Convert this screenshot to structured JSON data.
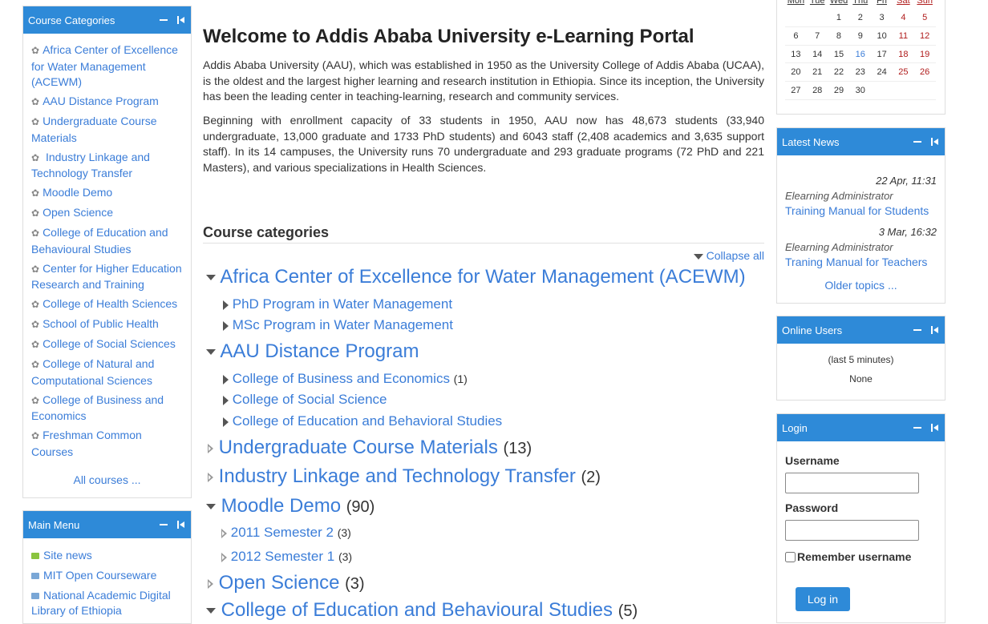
{
  "left": {
    "categories_block": {
      "title": "Course Categories",
      "items": [
        "Africa Center of Excellence for Water Management (ACEWM)",
        "AAU Distance Program",
        "Undergraduate Course Materials",
        " Industry Linkage and Technology Transfer",
        "Moodle Demo",
        "Open Science",
        "College of Education and Behavioural Studies",
        "Center for Higher Education Research and Training",
        "College of Health Sciences",
        "School of Public Health",
        "College of Social Sciences",
        "College of Natural and Computational Sciences",
        "College of Business and Economics",
        "Freshman Common Courses"
      ],
      "all_courses": "All courses ..."
    },
    "main_menu": {
      "title": "Main Menu",
      "items": [
        {
          "label": "Site news",
          "icon": "forum-icon"
        },
        {
          "label": "MIT Open Courseware",
          "icon": "url-icon"
        },
        {
          "label": "National Academic Digital Library of Ethiopia",
          "icon": "url-icon"
        }
      ]
    }
  },
  "main": {
    "title": "Welcome to Addis Ababa University e-Learning Portal",
    "paragraphs": [
      "Addis Ababa University (AAU), which was established in 1950 as the University College of Addis Ababa (UCAA), is the oldest and the largest higher learning and research institution in Ethiopia. Since its inception, the University has been the leading center in teaching-learning, research and community services.",
      "Beginning with enrollment capacity of 33 students in 1950, AAU now has 48,673 students (33,940 undergraduate, 13,000 graduate and 1733 PhD students) and 6043 staff (2,408 academics and 3,635 support staff). In its 14 campuses, the University runs 70 undergraduate and 293 graduate programs (72 PhD and 221 Masters), and various specializations in Health Sciences."
    ],
    "categories_heading": "Course categories",
    "collapse_all": "Collapse all",
    "tree": [
      {
        "label": "Africa Center of Excellence for Water Management (ACEWM)",
        "count": ""
      },
      {
        "label": "PhD Program in Water Management",
        "count": ""
      },
      {
        "label": "MSc Program in Water Management",
        "count": ""
      },
      {
        "label": "AAU Distance Program",
        "count": ""
      },
      {
        "label": "College of Business and Economics",
        "count": "(1)"
      },
      {
        "label": "College of Social Science",
        "count": ""
      },
      {
        "label": "College of Education and Behavioral Studies",
        "count": ""
      },
      {
        "label": "Undergraduate Course Materials",
        "count": "(13)"
      },
      {
        "label": "Industry Linkage and Technology Transfer",
        "count": "(2)"
      },
      {
        "label": "Moodle Demo",
        "count": "(90)"
      },
      {
        "label": "2011 Semester 2",
        "count": "(3)"
      },
      {
        "label": "2012 Semester 1",
        "count": "(3)"
      },
      {
        "label": "Open Science",
        "count": "(3)"
      },
      {
        "label": "College of Education and Behavioural Studies",
        "count": "(5)"
      }
    ]
  },
  "right": {
    "calendar": {
      "weekdays": [
        "Mon",
        "Tue",
        "Wed",
        "Thu",
        "Fri",
        "Sat",
        "Sun"
      ],
      "weeks": [
        [
          "",
          "",
          "1",
          "2",
          "3",
          "4",
          "5"
        ],
        [
          "6",
          "7",
          "8",
          "9",
          "10",
          "11",
          "12"
        ],
        [
          "13",
          "14",
          "15",
          "16",
          "17",
          "18",
          "19"
        ],
        [
          "20",
          "21",
          "22",
          "23",
          "24",
          "25",
          "26"
        ],
        [
          "27",
          "28",
          "29",
          "30",
          "",
          "",
          ""
        ]
      ],
      "today": "16"
    },
    "news": {
      "title": "Latest News",
      "items": [
        {
          "date": "22 Apr, 11:31",
          "author": "Elearning Administrator",
          "title": "Training Manual for Students"
        },
        {
          "date": "3 Mar, 16:32",
          "author": "Elearning Administrator",
          "title": "Traning Manual for Teachers"
        }
      ],
      "older": "Older topics ..."
    },
    "online_users": {
      "title": "Online Users",
      "note": "(last 5 minutes)",
      "none": "None"
    },
    "login": {
      "title": "Login",
      "username_label": "Username",
      "username_value": "",
      "password_label": "Password",
      "password_value": "",
      "remember_label": "Remember username",
      "button": "Log in"
    }
  },
  "colors": {
    "accent": "#2e8ad8",
    "link": "#3b7dd8",
    "weekend": "#b01c1c"
  }
}
